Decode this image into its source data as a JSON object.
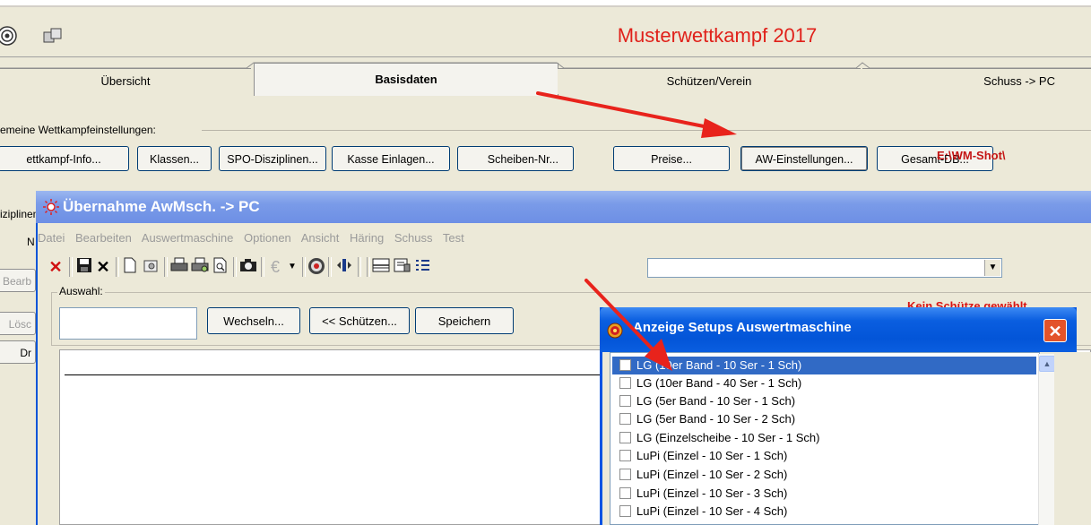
{
  "app": {
    "title": "Musterwettkampf 2017"
  },
  "tabs": [
    {
      "label": "Übersicht"
    },
    {
      "label": "Basisdaten"
    },
    {
      "label": "Schützen/Verein"
    },
    {
      "label": "Schuss -> PC"
    }
  ],
  "group": {
    "label": "emeine Wettkampfeinstellungen:",
    "buttons": [
      "ettkampf-Info...",
      "Klassen...",
      "SPO-Disziplinen...",
      "Kasse Einlagen...",
      "Scheiben-Nr...",
      "Preise...",
      "AW-Einstellungen...",
      "Gesamt-DB..."
    ],
    "path_label": "E:\\WM-Shot\\"
  },
  "left_panel": {
    "label_top": "iziplinen",
    "label_n": "N",
    "btn_bearb": "Bearb",
    "btn_losc": "Lösc",
    "btn_dr": "Dr"
  },
  "child_window": {
    "title": "Übernahme AwMsch. -> PC",
    "menu": [
      "Datei",
      "Bearbeiten",
      "Auswertmaschine",
      "Optionen",
      "Ansicht",
      "Häring",
      "Schuss",
      "Test"
    ],
    "auswahl_label": "Auswahl:",
    "buttons": {
      "wechseln": "Wechseln...",
      "schuetzen": "<< Schützen...",
      "speichern": "Speichern"
    },
    "status": "Kein Schütze gewählt"
  },
  "dialog": {
    "title": "Anzeige Setups Auswertmaschine",
    "close": "✕",
    "items": [
      {
        "label": "LG (10er Band - 10 Ser - 1 Sch)",
        "selected": true
      },
      {
        "label": "LG (10er Band - 40 Ser - 1 Sch)",
        "selected": false
      },
      {
        "label": "LG (5er Band - 10 Ser - 1 Sch)",
        "selected": false
      },
      {
        "label": "LG (5er Band - 10 Ser - 2 Sch)",
        "selected": false
      },
      {
        "label": "LG (Einzelscheibe - 10 Ser - 1 Sch)",
        "selected": false
      },
      {
        "label": "LuPi (Einzel - 10 Ser - 1 Sch)",
        "selected": false
      },
      {
        "label": "LuPi (Einzel - 10 Ser - 2 Sch)",
        "selected": false
      },
      {
        "label": "LuPi (Einzel - 10 Ser - 3 Sch)",
        "selected": false
      },
      {
        "label": "LuPi (Einzel - 10 Ser - 4 Sch)",
        "selected": false
      }
    ]
  },
  "colors": {
    "title_red": "#e0211a",
    "annotation_arrow": "#e8231c",
    "dialog_blue": "#0054e3"
  }
}
